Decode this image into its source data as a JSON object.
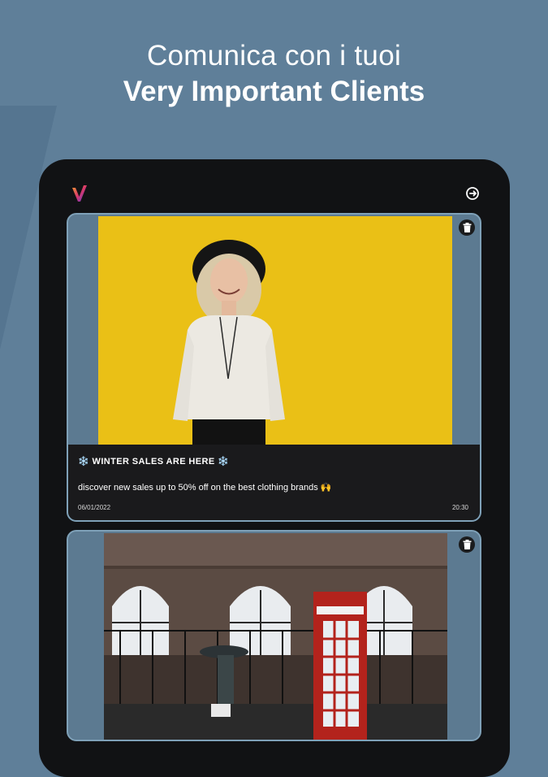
{
  "header": {
    "line1": "Comunica con i tuoi",
    "line2": "Very Important Clients"
  },
  "app": {
    "logo_icon": "v-logo-icon",
    "logout_icon": "logout-icon"
  },
  "posts": [
    {
      "title": "❄️ WINTER SALES ARE HERE ❄️",
      "body": "discover new sales up to 50% off on the best clothing brands 🙌",
      "date": "06/01/2022",
      "time": "20:30",
      "image": "woman-in-hat-yellow-wall-photo",
      "delete_icon": "trash-icon"
    },
    {
      "image": "red-telephone-box-street-photo",
      "delete_icon": "trash-icon"
    }
  ],
  "colors": {
    "background": "#5f7f99",
    "tablet": "#111214",
    "card": "#5c7a91",
    "card_border": "#7fa1b8",
    "caption_bg": "#1a1a1c",
    "photo1_bg": "#ecc11b",
    "phone_box_red": "#b3231c"
  }
}
